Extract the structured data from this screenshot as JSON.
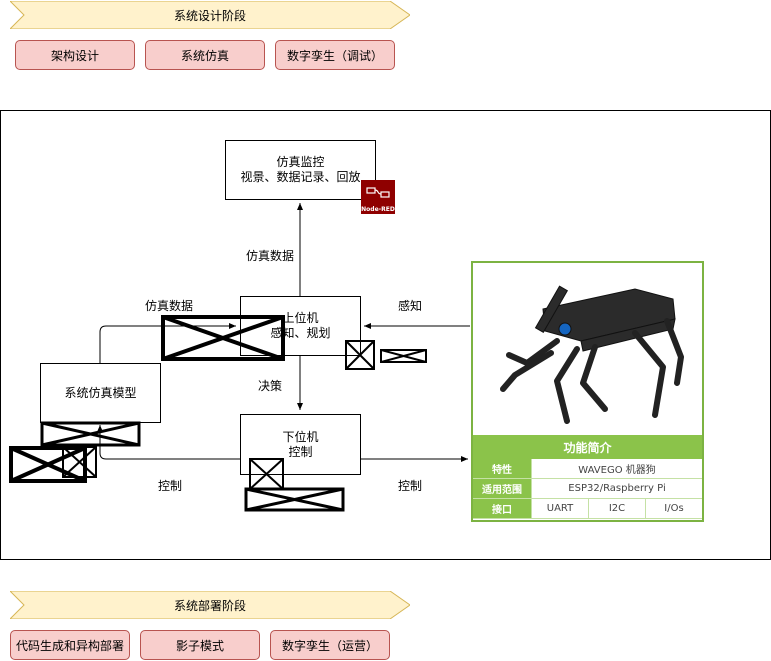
{
  "top_stage": {
    "banner": "系统设计阶段",
    "steps": [
      "架构设计",
      "系统仿真",
      "数字孪生（调试）"
    ]
  },
  "bottom_stage": {
    "banner": "系统部署阶段",
    "steps": [
      "代码生成和异构部署",
      "影子模式",
      "数字孪生（运营）"
    ]
  },
  "diagram": {
    "monitor": {
      "line1": "仿真监控",
      "line2": "视景、数据记录、回放"
    },
    "node_red_badge": "Node-RED",
    "upper": {
      "line1": "上位机",
      "line2": "感知、规划"
    },
    "lower": {
      "line1": "下位机",
      "line2": "控制"
    },
    "sim_model": "系统仿真模型",
    "edges": {
      "sim_data_up": "仿真数据",
      "sim_data_left": "仿真数据",
      "perceive": "感知",
      "decision": "决策",
      "control_left": "控制",
      "control_right": "控制"
    }
  },
  "robot_card": {
    "title": "功能简介",
    "rows": [
      {
        "key": "特性",
        "values": [
          "WAVEGO 机器狗"
        ]
      },
      {
        "key": "适用范围",
        "values": [
          "ESP32/Raspberry Pi"
        ]
      },
      {
        "key": "接口",
        "values": [
          "UART",
          "I2C",
          "I/Os"
        ]
      }
    ],
    "accent_color": "#8bc34a"
  }
}
